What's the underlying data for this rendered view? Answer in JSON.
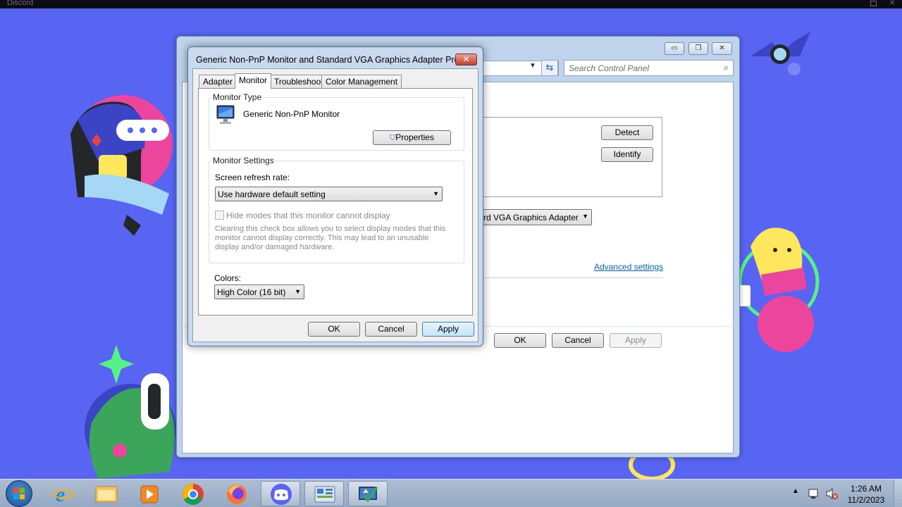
{
  "desktop": {
    "app_title": "Discord"
  },
  "backwindow": {
    "search_placeholder": "Search Control Panel",
    "detect_label": "Detect",
    "identify_label": "Identify",
    "adapter_value": "rd VGA Graphics Adapter",
    "advanced_link": "Advanced settings",
    "ok_label": "OK",
    "cancel_label": "Cancel",
    "apply_label": "Apply"
  },
  "dialog": {
    "title": "Generic Non-PnP Monitor and Standard VGA Graphics Adapter Pro...",
    "tabs": [
      {
        "label": "Adapter"
      },
      {
        "label": "Monitor"
      },
      {
        "label": "Troubleshoot"
      },
      {
        "label": "Color Management"
      }
    ],
    "active_tab": "Monitor",
    "monitor_type": {
      "heading": "Monitor Type",
      "monitor_name": "Generic Non-PnP Monitor",
      "properties_label": "Properties"
    },
    "monitor_settings": {
      "heading": "Monitor Settings",
      "refresh_label": "Screen refresh rate:",
      "refresh_value": "Use hardware default setting",
      "hide_modes_label": "Hide modes that this monitor cannot display",
      "hide_modes_checked": false,
      "hide_modes_help": "Clearing this check box allows you to select display modes that this monitor cannot display correctly. This may lead to an unusable display and/or damaged hardware."
    },
    "colors": {
      "label": "Colors:",
      "value": "High Color (16 bit)"
    },
    "ok_label": "OK",
    "cancel_label": "Cancel",
    "apply_label": "Apply"
  },
  "taskbar": {
    "time": "1:26 AM",
    "date": "11/2/2023",
    "apps": [
      {
        "name": "Internet Explorer",
        "icon": "internet-explorer-icon"
      },
      {
        "name": "Windows Explorer",
        "icon": "folder-icon"
      },
      {
        "name": "Windows Media Player",
        "icon": "media-player-icon"
      },
      {
        "name": "Google Chrome",
        "icon": "chrome-icon"
      },
      {
        "name": "Firefox",
        "icon": "firefox-icon"
      },
      {
        "name": "Discord",
        "icon": "discord-icon"
      },
      {
        "name": "Control Panel",
        "icon": "control-panel-icon"
      },
      {
        "name": "Display Settings",
        "icon": "display-settings-icon"
      }
    ]
  },
  "colors": {
    "desktop_bg": "#5865f2",
    "dialog_frame": "#c9d9ee",
    "close_red": "#c0402e",
    "link_blue": "#0066cc"
  }
}
